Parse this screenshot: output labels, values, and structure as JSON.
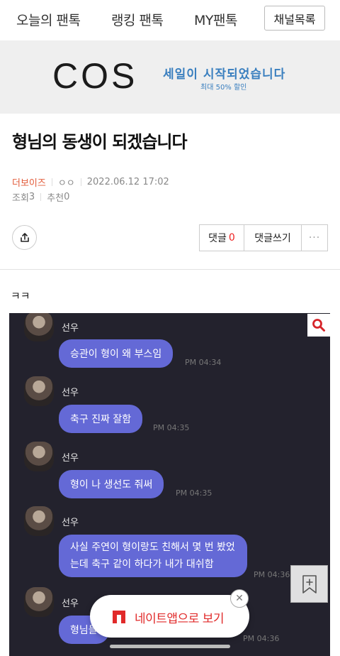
{
  "nav": {
    "items": [
      "오늘의 팬톡",
      "랭킹 팬톡",
      "MY팬톡"
    ],
    "channel_list": "채널목록"
  },
  "ad": {
    "logo": "COS",
    "headline": "세일이 시작되었습니다",
    "subline": "최대 50% 할인",
    "brand_color": "#3a7fbf"
  },
  "article": {
    "title": "형님의 동생이 되겠습니다",
    "author": "더보이즈",
    "nickname": "ㅇㅇ",
    "datetime": "2022.06.12 17:02",
    "views_label": "조회",
    "views": "3",
    "likes_label": "추천",
    "likes": "0",
    "body": "ㅋㅋ"
  },
  "actions": {
    "comment_label": "댓글",
    "comment_count": "0",
    "write_comment": "댓글쓰기",
    "more": "···"
  },
  "chat": {
    "messages": [
      {
        "sender": "선우",
        "text": "승관이 형이 왜 부스임",
        "time": "PM 04:34"
      },
      {
        "sender": "선우",
        "text": "축구 진짜 잘함",
        "time": "PM 04:35"
      },
      {
        "sender": "선우",
        "text": "형이 나 생선도 줘써",
        "time": "PM 04:35"
      },
      {
        "sender": "선우",
        "text": "사실 주연이 형이랑도 친해서 몇 번 봤었는데 축구 같이 하다가 내가 대쉬함",
        "time": "PM 04:36"
      },
      {
        "sender": "선우",
        "text": "형님들",
        "time": "PM 04:36"
      }
    ]
  },
  "app_banner": {
    "label": "네이트앱으로 보기",
    "accent": "#e12a2a"
  },
  "icons": [
    "share-icon",
    "search-icon",
    "bookmark-add-icon",
    "nate-logo-icon",
    "close-icon"
  ]
}
